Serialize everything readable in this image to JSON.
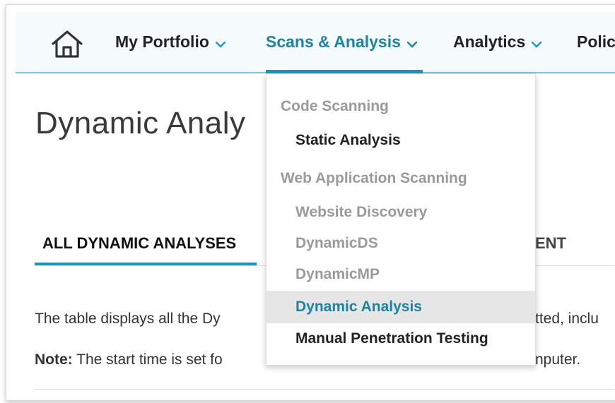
{
  "nav": {
    "items": [
      {
        "label": "My Portfolio"
      },
      {
        "label": "Scans & Analysis"
      },
      {
        "label": "Analytics"
      },
      {
        "label": "Polic"
      }
    ]
  },
  "page": {
    "title": "Dynamic Analy",
    "tabs": [
      {
        "label": "ALL DYNAMIC ANALYSES"
      },
      {
        "label": "ENT"
      }
    ],
    "description_visible_start": "The table displays all the Dy",
    "description_visible_end": "tted, inclu",
    "note_label": "Note:",
    "note_visible_start": " The start time is set fo",
    "note_visible_end": "nputer."
  },
  "dropdown": {
    "sections": [
      {
        "heading": "Code Scanning",
        "items": [
          {
            "label": "Static Analysis"
          }
        ]
      },
      {
        "heading": "Web Application Scanning",
        "items": [
          {
            "label": "Website Discovery"
          },
          {
            "label": "DynamicDS"
          },
          {
            "label": "DynamicMP"
          },
          {
            "label": "Dynamic Analysis"
          },
          {
            "label": "Manual Penetration Testing"
          }
        ]
      }
    ]
  },
  "colors": {
    "accent": "#1e95bd",
    "active_text": "#1e82a3",
    "muted_text": "#9a9a9a",
    "highlight_bg": "#e6e6e6"
  }
}
